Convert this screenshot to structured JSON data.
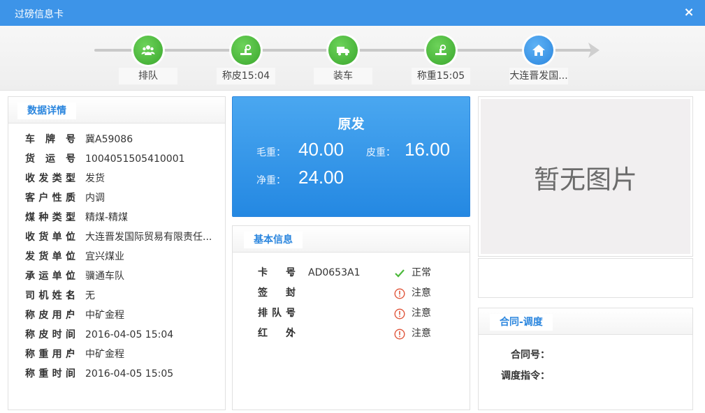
{
  "window": {
    "title": "过磅信息卡",
    "close_label": "×"
  },
  "steps": [
    {
      "label": "排队",
      "icon": "people-icon",
      "color": "#4cb93b"
    },
    {
      "label": "称皮15:04",
      "icon": "scale-icon",
      "color": "#4cb93b"
    },
    {
      "label": "装车",
      "icon": "truck-icon",
      "color": "#4cb93b"
    },
    {
      "label": "称重15:05",
      "icon": "scale-icon",
      "color": "#4cb93b"
    },
    {
      "label": "大连晋发国...",
      "icon": "home-icon",
      "color": "#2b86de"
    }
  ],
  "details": {
    "title": "数据详情",
    "rows": [
      {
        "key": "车牌号",
        "value": "冀A59086"
      },
      {
        "key": "货运号",
        "value": "1004051505410001"
      },
      {
        "key": "收发类型",
        "value": "发货"
      },
      {
        "key": "客户性质",
        "value": "内调"
      },
      {
        "key": "煤种类型",
        "value": "精煤-精煤"
      },
      {
        "key": "收货单位",
        "value": "大连晋发国际贸易有限责任..."
      },
      {
        "key": "发货单位",
        "value": "宜兴煤业"
      },
      {
        "key": "承运单位",
        "value": "骥通车队"
      },
      {
        "key": "司机姓名",
        "value": "无"
      },
      {
        "key": "称皮用户",
        "value": "中矿金程"
      },
      {
        "key": "称皮时间",
        "value": "2016-04-05 15:04"
      },
      {
        "key": "称重用户",
        "value": "中矿金程"
      },
      {
        "key": "称重时间",
        "value": "2016-04-05 15:05"
      }
    ]
  },
  "weight": {
    "title": "原发",
    "gross_label": "毛重：",
    "gross_value": "40.00",
    "tare_label": "皮重：",
    "tare_value": "16.00",
    "net_label": "净重：",
    "net_value": "24.00"
  },
  "basic": {
    "title": "基本信息",
    "rows": [
      {
        "key": "卡号",
        "value": "AD0653A1",
        "status": "正常",
        "status_type": "ok"
      },
      {
        "key": "签封",
        "value": "",
        "status": "注意",
        "status_type": "warn"
      },
      {
        "key": "排队号",
        "value": "",
        "status": "注意",
        "status_type": "warn"
      },
      {
        "key": "红外",
        "value": "",
        "status": "注意",
        "status_type": "warn"
      }
    ],
    "colors": {
      "ok": "#4cb93b",
      "warn": "#e0563b"
    }
  },
  "photo": {
    "placeholder": "暂无图片"
  },
  "contract": {
    "title": "合同-调度",
    "rows": [
      {
        "key": "合同号：",
        "value": ""
      },
      {
        "key": "调度指令：",
        "value": ""
      }
    ]
  }
}
